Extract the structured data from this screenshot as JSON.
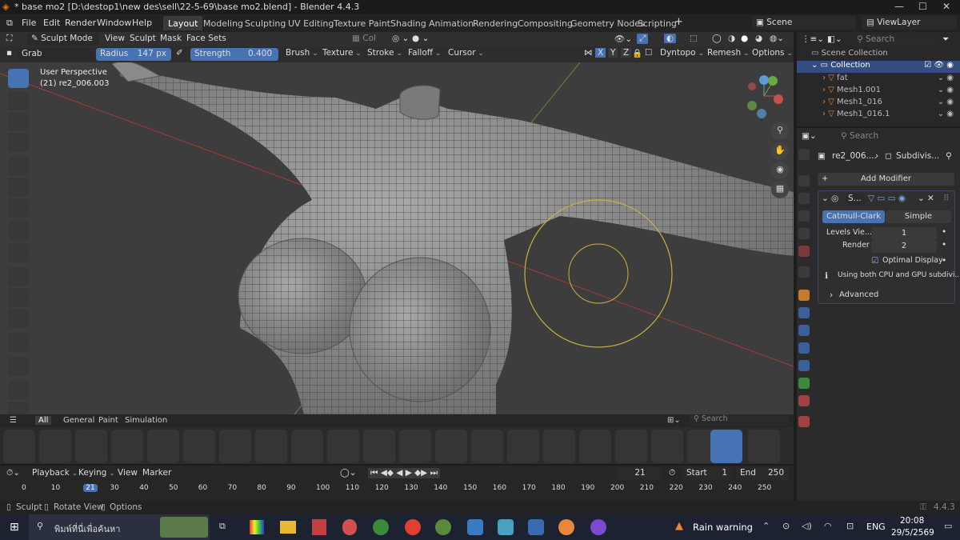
{
  "window": {
    "title": "* base mo2 [D:\\destop1\\new des\\sell\\22-5-69\\base mo2.blend] - Blender 4.4.3"
  },
  "menu": [
    "File",
    "Edit",
    "Render",
    "Window",
    "Help"
  ],
  "workspaces": [
    "Layout",
    "Modeling",
    "Sculpting",
    "UV Editing",
    "Texture Paint",
    "Shading",
    "Animation",
    "Rendering",
    "Compositing",
    "Geometry Nodes",
    "Scripting"
  ],
  "scene_label": "Scene",
  "viewlayer_label": "ViewLayer",
  "header": {
    "mode": "Sculpt Mode",
    "items": [
      "View",
      "Sculpt",
      "Mask",
      "Face Sets"
    ],
    "col": "Col"
  },
  "toolsettings": {
    "brush": "Grab",
    "radius_label": "Radius",
    "radius_value": "147 px",
    "strength_label": "Strength",
    "strength_value": "0.400",
    "menus": [
      "Brush",
      "Texture",
      "Stroke",
      "Falloff",
      "Cursor"
    ],
    "axes": [
      "X",
      "Y",
      "Z"
    ],
    "dyntopo": "Dyntopo",
    "remesh": "Remesh",
    "options": "Options"
  },
  "overlay": {
    "view": "User Perspective",
    "object": "(21) re2_006.003"
  },
  "brush_tabs": [
    "All",
    "General",
    "Paint",
    "Simulation"
  ],
  "brush_search_placeholder": "Search",
  "timeline": {
    "menus": [
      "Playback",
      "Keying",
      "View",
      "Marker"
    ],
    "current_frame": "21",
    "start_label": "Start",
    "start": "1",
    "end_label": "End",
    "end": "250",
    "ticks": [
      "0",
      "10",
      "21",
      "30",
      "40",
      "50",
      "60",
      "70",
      "80",
      "90",
      "100",
      "110",
      "120",
      "130",
      "140",
      "150",
      "160",
      "170",
      "180",
      "190",
      "200",
      "210",
      "220",
      "230",
      "240",
      "250"
    ]
  },
  "outliner": {
    "search_placeholder": "Search",
    "scene_collection": "Scene Collection",
    "collection": "Collection",
    "items": [
      "fat",
      "Mesh1.001",
      "Mesh1_016",
      "Mesh1_016.1"
    ]
  },
  "properties": {
    "search_placeholder": "Search",
    "breadcrumb_object": "re2_006....",
    "breadcrumb_modifier": "Subdivis...",
    "add_modifier": "Add Modifier",
    "modifier_name": "S...",
    "catmull": "Catmull-Clark",
    "simple": "Simple",
    "levels_label": "Levels Vie...",
    "levels_value": "1",
    "render_label": "Render",
    "render_value": "2",
    "optimal": "Optimal Display",
    "info": "Using both CPU and GPU subdivi...",
    "advanced": "Advanced"
  },
  "status": {
    "left": "Sculpt",
    "middle": "Rotate View",
    "right": "Options",
    "version": "4.4.3"
  },
  "taskbar": {
    "search_placeholder": "พิมพ์ที่นี่เพื่อค้นหา",
    "weather": "Rain warning",
    "lang": "ENG",
    "time": "20:08",
    "date": "29/5/2569"
  },
  "colors": {
    "accent": "#4772b3",
    "active_tool": "#4772b3",
    "brush_circle": "#c8b33a"
  }
}
